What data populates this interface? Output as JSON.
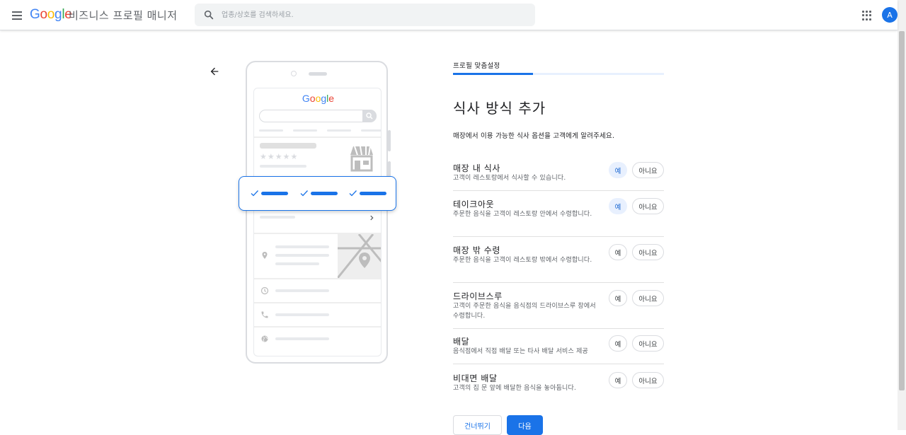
{
  "header": {
    "logo_letters": [
      "G",
      "o",
      "o",
      "g",
      "l",
      "e"
    ],
    "product_name": "비즈니스 프로필 매니저",
    "search_placeholder": "업종/상호를 검색하세요.",
    "avatar_letter": "A"
  },
  "illustration": {
    "logo_letters": [
      "G",
      "o",
      "o",
      "g",
      "l",
      "e"
    ],
    "stars": "★★★★★"
  },
  "step": {
    "label": "프로필 맞춤설정",
    "progress": 0.38
  },
  "page": {
    "title": "식사 방식 추가",
    "description": "매장에서 이용 가능한 식사 옵션을 고객에게 알려주세요."
  },
  "options": [
    {
      "title": "매장 내 식사",
      "description": "고객이 레스토랑에서 식사할 수 있습니다.",
      "yes_label": "예",
      "no_label": "아니요",
      "selected": "yes"
    },
    {
      "title": "테이크아웃",
      "description": "주문한 음식을 고객이 레스토랑 안에서 수령합니다.",
      "yes_label": "예",
      "no_label": "아니요",
      "selected": "yes"
    },
    {
      "title": "매장 밖 수령",
      "description": "주문한 음식을 고객이 레스토랑 밖에서 수령합니다.",
      "yes_label": "예",
      "no_label": "아니요",
      "selected": "none"
    },
    {
      "title": "드라이브스루",
      "description": "고객이 주문한 음식을 음식점의 드라이브스루 창에서 수령합니다.",
      "yes_label": "예",
      "no_label": "아니요",
      "selected": "none"
    },
    {
      "title": "배달",
      "description": "음식점에서 직접 배달 또는 타사 배달 서비스 제공",
      "yes_label": "예",
      "no_label": "아니요",
      "selected": "none"
    },
    {
      "title": "비대면 배달",
      "description": "고객의 집 문 앞에 배달한 음식을 놓아둡니다.",
      "yes_label": "예",
      "no_label": "아니요",
      "selected": "none"
    }
  ],
  "actions": {
    "skip_label": "건너뛰기",
    "next_label": "다음"
  },
  "colors": {
    "accent": "#1a73e8",
    "selected_bg": "#e8f0fe"
  }
}
